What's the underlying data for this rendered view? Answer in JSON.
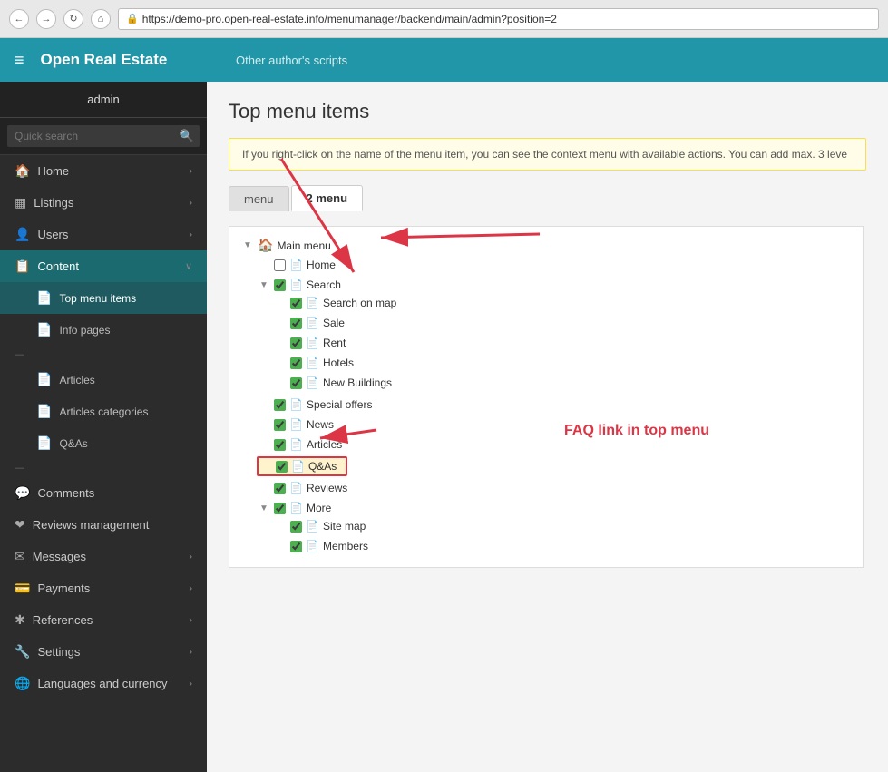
{
  "browser": {
    "url": "https://demo-pro.open-real-estate.info/menumanager/backend/main/admin?position=2",
    "domain": "open-real-estate.info",
    "back_label": "←",
    "forward_label": "→",
    "refresh_label": "↻",
    "home_label": "⌂"
  },
  "topbar": {
    "logo": "Open Real Estate",
    "menu_icon": "≡",
    "other_scripts": "Other author's scripts"
  },
  "sidebar": {
    "user": "admin",
    "search_placeholder": "Quick search",
    "items": [
      {
        "id": "home",
        "label": "Home",
        "icon": "🏠",
        "has_chevron": true
      },
      {
        "id": "listings",
        "label": "Listings",
        "icon": "▦",
        "has_chevron": true
      },
      {
        "id": "users",
        "label": "Users",
        "icon": "👤",
        "has_chevron": true
      },
      {
        "id": "content",
        "label": "Content",
        "icon": "📋",
        "has_chevron": true,
        "active": true
      },
      {
        "id": "top-menu-items",
        "label": "Top menu items",
        "icon": "📄",
        "sub": true,
        "active_sub": true
      },
      {
        "id": "info-pages",
        "label": "Info pages",
        "icon": "📄",
        "sub": true
      },
      {
        "id": "div1",
        "divider": true
      },
      {
        "id": "articles",
        "label": "Articles",
        "icon": "📄",
        "sub": true
      },
      {
        "id": "articles-categories",
        "label": "Articles categories",
        "icon": "📄",
        "sub": true
      },
      {
        "id": "qas",
        "label": "Q&As",
        "icon": "📄",
        "sub": true
      },
      {
        "id": "div2",
        "divider": true
      },
      {
        "id": "comments",
        "label": "Comments",
        "icon": "💬"
      },
      {
        "id": "reviews",
        "label": "Reviews management",
        "icon": "❤"
      },
      {
        "id": "messages",
        "label": "Messages",
        "icon": "✉",
        "has_chevron": true
      },
      {
        "id": "payments",
        "label": "Payments",
        "icon": "💳",
        "has_chevron": true
      },
      {
        "id": "references",
        "label": "References",
        "icon": "✱",
        "has_chevron": true
      },
      {
        "id": "settings",
        "label": "Settings",
        "icon": "🔧",
        "has_chevron": true
      },
      {
        "id": "languages",
        "label": "Languages and currency",
        "icon": "🌐",
        "has_chevron": true
      }
    ]
  },
  "content": {
    "page_title": "Top menu items",
    "alert_text": "If you right-click on the name of the menu item, you can see the context menu with available actions. You can add max. 3 leve",
    "tabs": [
      {
        "id": "menu1",
        "label": "menu",
        "active": false
      },
      {
        "id": "menu2",
        "label": "2 menu",
        "active": true
      }
    ],
    "tree": {
      "root": {
        "label": "Main menu",
        "children": [
          {
            "label": "Home",
            "checked": false,
            "checked_show": false
          },
          {
            "label": "Search",
            "checked": true,
            "children": [
              {
                "label": "Search on map",
                "checked": true
              },
              {
                "label": "Sale",
                "checked": true
              },
              {
                "label": "Rent",
                "checked": true
              },
              {
                "label": "Hotels",
                "checked": true
              },
              {
                "label": "New Buildings",
                "checked": true
              }
            ]
          },
          {
            "label": "Special offers",
            "checked": true
          },
          {
            "label": "News",
            "checked": true
          },
          {
            "label": "Articles",
            "checked": true
          },
          {
            "label": "Q&As",
            "checked": true,
            "highlighted": true
          },
          {
            "label": "Reviews",
            "checked": true
          },
          {
            "label": "More",
            "checked": true,
            "children": [
              {
                "label": "Site map",
                "checked": true
              },
              {
                "label": "Members",
                "checked": true
              }
            ]
          }
        ]
      }
    },
    "faq_annotation": "FAQ link in top menu"
  }
}
